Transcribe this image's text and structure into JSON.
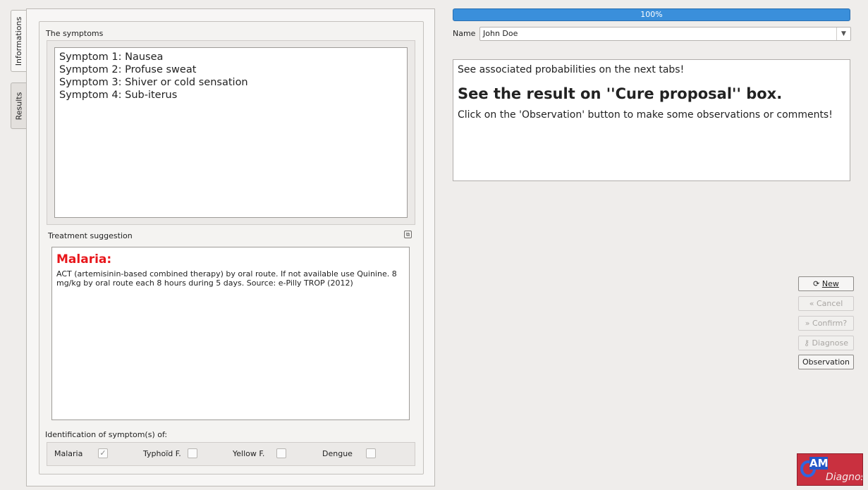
{
  "tabs": {
    "informations": "Informations",
    "results": "Results"
  },
  "symptoms": {
    "title": "The symptoms",
    "lines": [
      "Symptom 1: Nausea",
      "Symptom 2: Profuse sweat",
      "Symptom 3: Shiver or cold sensation",
      "Symptom 4: Sub-iterus"
    ]
  },
  "treatment": {
    "title": "Treatment suggestion",
    "disease": "Malaria:",
    "text": "ACT (artemisinin-based combined therapy) by oral route. If not available use Quinine. 8 mg/kg by oral route each 8 hours during 5 days. Source: e-Pilly TROP (2012)"
  },
  "identification": {
    "title": "Identification of symptom(s) of:",
    "items": [
      {
        "label": "Malaria",
        "checked": true
      },
      {
        "label": "Typhoïd F.",
        "checked": false
      },
      {
        "label": "Yellow F.",
        "checked": false
      },
      {
        "label": "Dengue",
        "checked": false
      }
    ]
  },
  "progress": {
    "value": 100,
    "text": "100%"
  },
  "name_field": {
    "label": "Name",
    "value": "John Doe"
  },
  "info": {
    "line1": "See associated probabilities on the next tabs!",
    "line2": "See the result on ''Cure proposal'' box.",
    "line3": "Click on the 'Observation' button to make some observations or comments!"
  },
  "buttons": {
    "new": "New",
    "cancel": "Cancel",
    "confirm": "Confirm?",
    "diagnose": "Diagnose",
    "observation": "Observation"
  },
  "logo": {
    "am": "AM",
    "text": "Diagnos"
  },
  "colors": {
    "accent": "#3a8fdb",
    "disease_title": "#e8161b"
  }
}
